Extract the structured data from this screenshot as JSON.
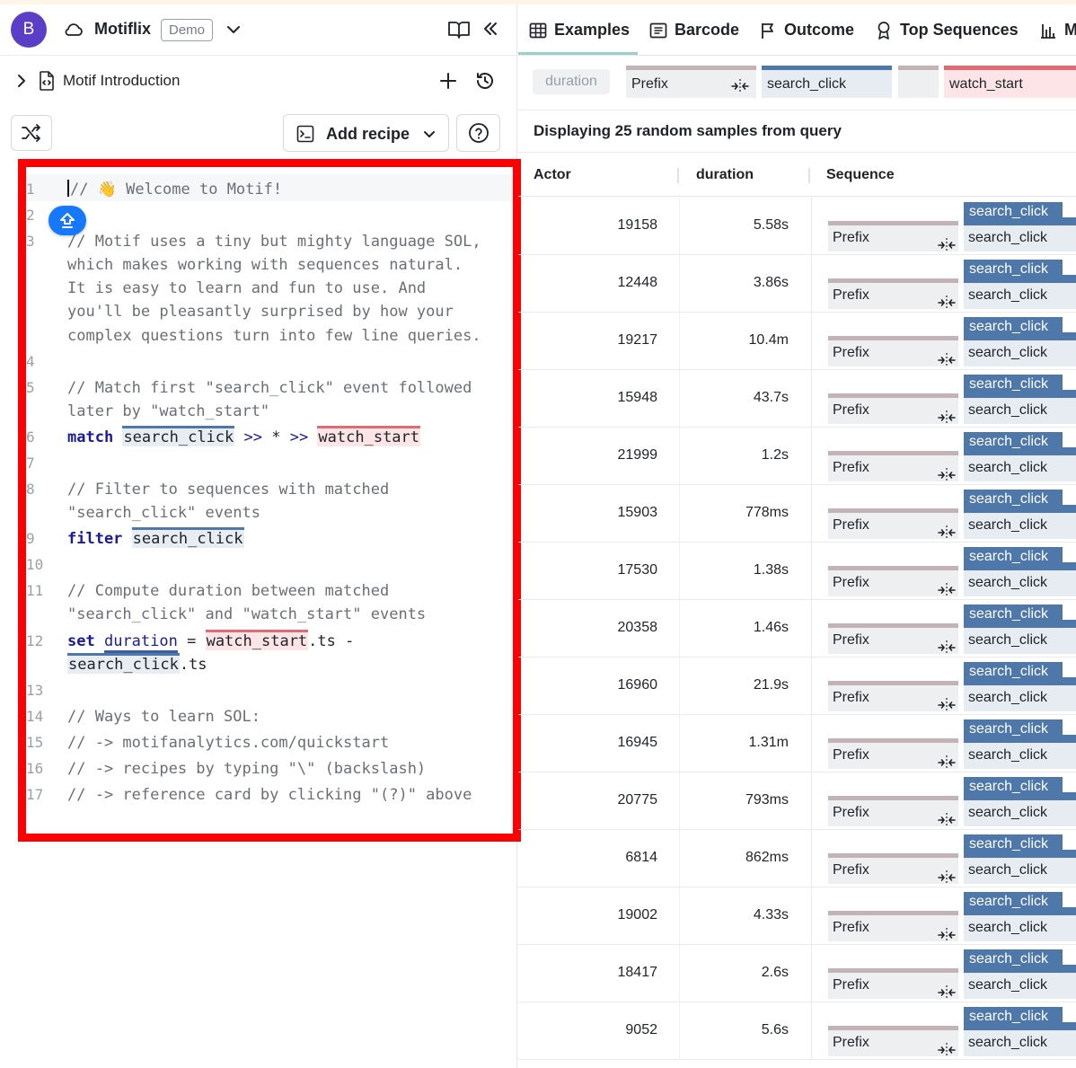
{
  "app": {
    "avatar_letter": "B",
    "name": "Motiflix",
    "badge": "Demo"
  },
  "file": {
    "name": "Motif Introduction"
  },
  "toolbar": {
    "add_recipe_label": "Add recipe"
  },
  "editor": {
    "lines": [
      {
        "n": "1",
        "segments": [
          {
            "t": "// 👋 Welcome to Motif!",
            "c": "comment"
          }
        ],
        "caret": true
      },
      {
        "n": "2",
        "segments": []
      },
      {
        "n": "3",
        "segments": [
          {
            "t": "// Motif uses a tiny but mighty language SOL,",
            "c": "comment"
          }
        ]
      },
      {
        "n": "",
        "segments": [
          {
            "t": "which makes working with sequences natural.",
            "c": "comment"
          }
        ]
      },
      {
        "n": "",
        "segments": [
          {
            "t": "It is easy to learn and fun to use. And",
            "c": "comment"
          }
        ]
      },
      {
        "n": "",
        "segments": [
          {
            "t": "you'll be pleasantly surprised by how your",
            "c": "comment"
          }
        ]
      },
      {
        "n": "",
        "segments": [
          {
            "t": "complex questions turn into few line queries.",
            "c": "comment"
          }
        ]
      },
      {
        "n": "4",
        "segments": []
      },
      {
        "n": "5",
        "segments": [
          {
            "t": "// Match first \"search_click\" event followed",
            "c": "comment"
          }
        ]
      },
      {
        "n": "",
        "segments": [
          {
            "t": "later by \"watch_start\"",
            "c": "comment"
          }
        ]
      },
      {
        "n": "6",
        "segments": [
          {
            "t": "match",
            "c": "kw"
          },
          {
            "t": " ",
            "c": "plain"
          },
          {
            "t": "search_click",
            "c": "hl-blue"
          },
          {
            "t": " >> ",
            "c": "op"
          },
          {
            "t": "*",
            "c": "plain"
          },
          {
            "t": " >> ",
            "c": "op"
          },
          {
            "t": "watch_start",
            "c": "hl-red"
          }
        ]
      },
      {
        "n": "7",
        "segments": []
      },
      {
        "n": "8",
        "segments": [
          {
            "t": "// Filter to sequences with matched",
            "c": "comment"
          }
        ]
      },
      {
        "n": "",
        "segments": [
          {
            "t": "\"search_click\" events",
            "c": "comment"
          }
        ]
      },
      {
        "n": "9",
        "segments": [
          {
            "t": "filter",
            "c": "kw"
          },
          {
            "t": " ",
            "c": "plain"
          },
          {
            "t": "search_click",
            "c": "hl-blue"
          }
        ]
      },
      {
        "n": "10",
        "segments": []
      },
      {
        "n": "11",
        "segments": [
          {
            "t": "// Compute duration between matched",
            "c": "comment"
          }
        ]
      },
      {
        "n": "",
        "segments": [
          {
            "t": "\"search_click\" and \"watch_start\" events",
            "c": "comment"
          }
        ]
      },
      {
        "n": "12",
        "segments": [
          {
            "t": "set",
            "c": "kw"
          },
          {
            "t": " ",
            "c": "plain"
          },
          {
            "t": "duration",
            "c": "var"
          },
          {
            "t": " = ",
            "c": "plain"
          },
          {
            "t": "watch_start",
            "c": "hl-red"
          },
          {
            "t": ".ts -",
            "c": "plain"
          }
        ]
      },
      {
        "n": "",
        "segments": [
          {
            "t": "search_click",
            "c": "hl-blue"
          },
          {
            "t": ".ts",
            "c": "plain"
          }
        ]
      },
      {
        "n": "13",
        "segments": []
      },
      {
        "n": "14",
        "segments": [
          {
            "t": "// Ways to learn SOL:",
            "c": "comment"
          }
        ]
      },
      {
        "n": "15",
        "segments": [
          {
            "t": "// -> motifanalytics.com/quickstart",
            "c": "comment"
          }
        ]
      },
      {
        "n": "16",
        "segments": [
          {
            "t": "// -> recipes by typing \"\\\" (backslash)",
            "c": "comment"
          }
        ]
      },
      {
        "n": "17",
        "segments": [
          {
            "t": "// -> reference card by clicking \"(?)\" above",
            "c": "comment"
          }
        ]
      }
    ]
  },
  "tabs": [
    {
      "label": "Examples",
      "icon": "table-icon",
      "active": true
    },
    {
      "label": "Barcode",
      "icon": "barcode-icon",
      "active": false
    },
    {
      "label": "Outcome",
      "icon": "flag-icon",
      "active": false
    },
    {
      "label": "Top Sequences",
      "icon": "award-icon",
      "active": false
    },
    {
      "label": "M",
      "icon": "bar-chart-icon",
      "active": false
    }
  ],
  "query": {
    "duration_chip": "duration",
    "prefix_label": "Prefix",
    "click_label": "search_click",
    "watch_label": "watch_start"
  },
  "results": {
    "summary": "Displaying 25 random samples from query",
    "columns": [
      "Actor",
      "duration",
      "Sequence"
    ],
    "rows": [
      {
        "actor": "19158",
        "duration": "5.58s"
      },
      {
        "actor": "12448",
        "duration": "3.86s"
      },
      {
        "actor": "19217",
        "duration": "10.4m"
      },
      {
        "actor": "15948",
        "duration": "43.7s"
      },
      {
        "actor": "21999",
        "duration": "1.2s"
      },
      {
        "actor": "15903",
        "duration": "778ms"
      },
      {
        "actor": "17530",
        "duration": "1.38s"
      },
      {
        "actor": "20358",
        "duration": "1.46s"
      },
      {
        "actor": "16960",
        "duration": "21.9s"
      },
      {
        "actor": "16945",
        "duration": "1.31m"
      },
      {
        "actor": "20775",
        "duration": "793ms"
      },
      {
        "actor": "6814",
        "duration": "862ms"
      },
      {
        "actor": "19002",
        "duration": "4.33s"
      },
      {
        "actor": "18417",
        "duration": "2.6s"
      },
      {
        "actor": "9052",
        "duration": "5.6s"
      }
    ],
    "sequence_prefix": "Prefix",
    "sequence_flag": "search_click",
    "sequence_event": "search_click"
  },
  "colors": {
    "accent_blue": "#4e77aa",
    "accent_red": "#e06b72",
    "avatar": "#5b3ec8",
    "fab": "#1677ff",
    "highlight_frame": "#ff0000"
  }
}
